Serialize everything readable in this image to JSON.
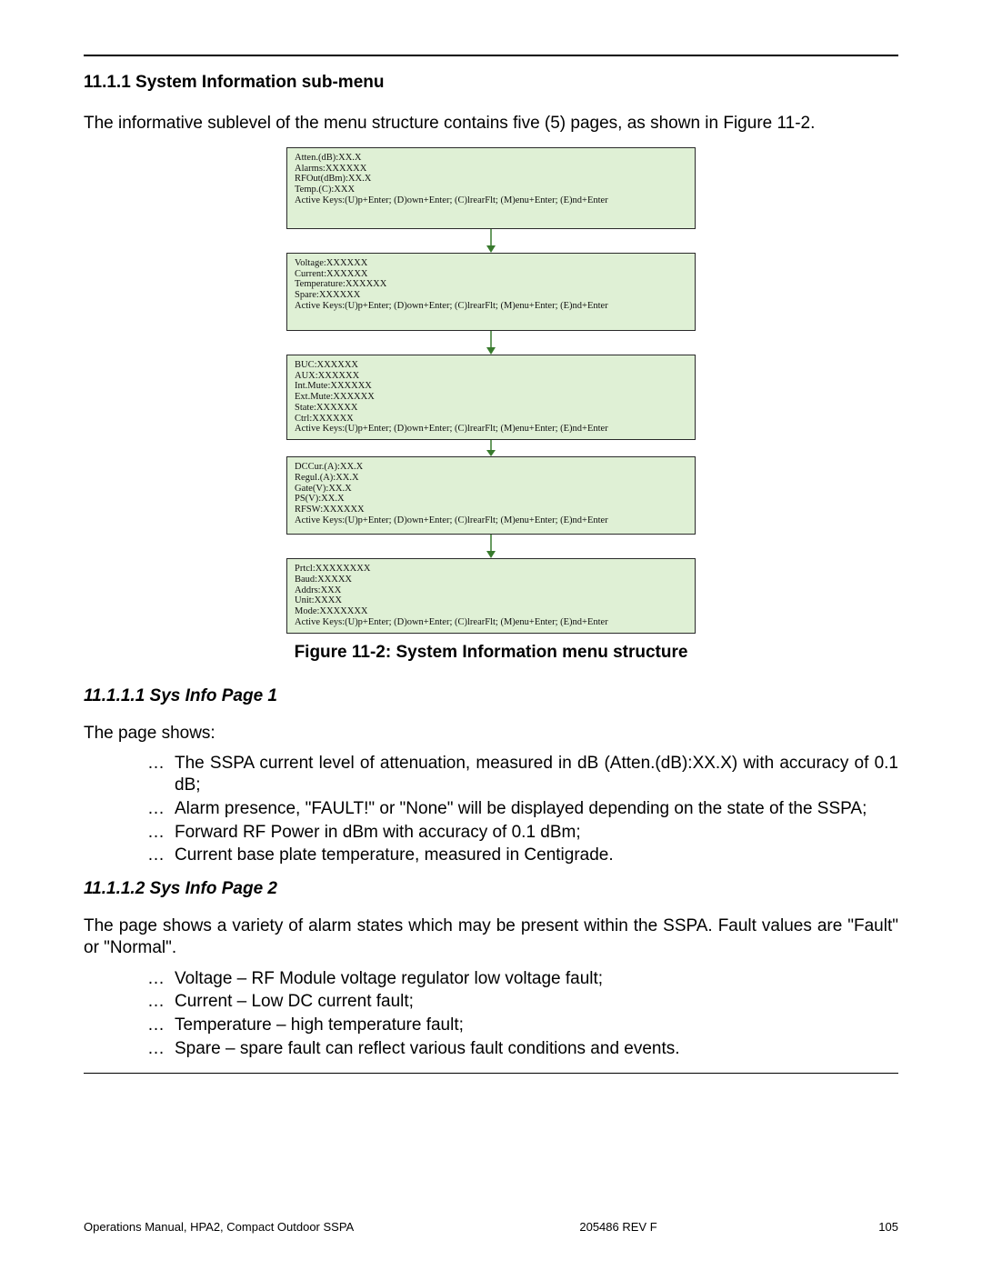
{
  "heading_section": "11.1.1 System Information sub-menu",
  "intro": "The informative sublevel of the menu structure contains five (5) pages, as shown in Figure 11-2.",
  "figure": {
    "caption": "Figure 11-2: System Information menu structure",
    "boxes": [
      {
        "lines": [
          "Atten.(dB):XX.X",
          "Alarms:XXXXXX",
          "RFOut(dBm):XX.X",
          "Temp.(C):XXX",
          "Active Keys:(U)p+Enter; (D)own+Enter; (C)lrearFlt; (M)enu+Enter; (E)nd+Enter"
        ]
      },
      {
        "lines": [
          "Voltage:XXXXXX",
          "Current:XXXXXX",
          "Temperature:XXXXXX",
          "Spare:XXXXXX",
          "Active Keys:(U)p+Enter; (D)own+Enter; (C)lrearFlt; (M)enu+Enter; (E)nd+Enter"
        ]
      },
      {
        "lines": [
          "BUC:XXXXXX",
          "AUX:XXXXXX",
          "Int.Mute:XXXXXX",
          "Ext.Mute:XXXXXX",
          "State:XXXXXX",
          "Ctrl:XXXXXX",
          "Active Keys:(U)p+Enter; (D)own+Enter; (C)lrearFlt; (M)enu+Enter; (E)nd+Enter"
        ]
      },
      {
        "lines": [
          "DCCur.(A):XX.X",
          "Regul.(A):XX.X",
          "Gate(V):XX.X",
          "PS(V):XX.X",
          "RFSW:XXXXXX",
          "Active Keys:(U)p+Enter; (D)own+Enter; (C)lrearFlt; (M)enu+Enter; (E)nd+Enter"
        ]
      },
      {
        "lines": [
          "Prtcl:XXXXXXXX",
          "Baud:XXXXX",
          "Addrs:XXX",
          "Unit:XXXX",
          "Mode:XXXXXXX",
          "Active Keys:(U)p+Enter; (D)own+Enter; (C)lrearFlt; (M)enu+Enter; (E)nd+Enter"
        ]
      }
    ]
  },
  "page1": {
    "heading": "11.1.1.1 Sys Info Page 1",
    "lead": "The page shows:",
    "items": [
      "The SSPA current level of attenuation, measured in dB (Atten.(dB):XX.X) with accuracy of 0.1 dB;",
      "Alarm presence, \"FAULT!\" or \"None\" will be displayed depending on the state of the SSPA;",
      "Forward RF Power in dBm with accuracy of 0.1 dBm;",
      "Current base plate temperature, measured in Centigrade."
    ]
  },
  "page2": {
    "heading": "11.1.1.2 Sys Info Page 2",
    "lead": "The page shows a variety of alarm states which may be present within the SSPA. Fault values are \"Fault\" or \"Normal\".",
    "items": [
      "Voltage – RF Module voltage regulator low voltage fault;",
      "Current – Low DC current fault;",
      "Temperature – high temperature fault;",
      "Spare – spare fault can reflect various fault conditions and events."
    ]
  },
  "footer": {
    "left": "Operations Manual, HPA2, Compact Outdoor SSPA",
    "center": "205486 REV F",
    "right": "105"
  }
}
